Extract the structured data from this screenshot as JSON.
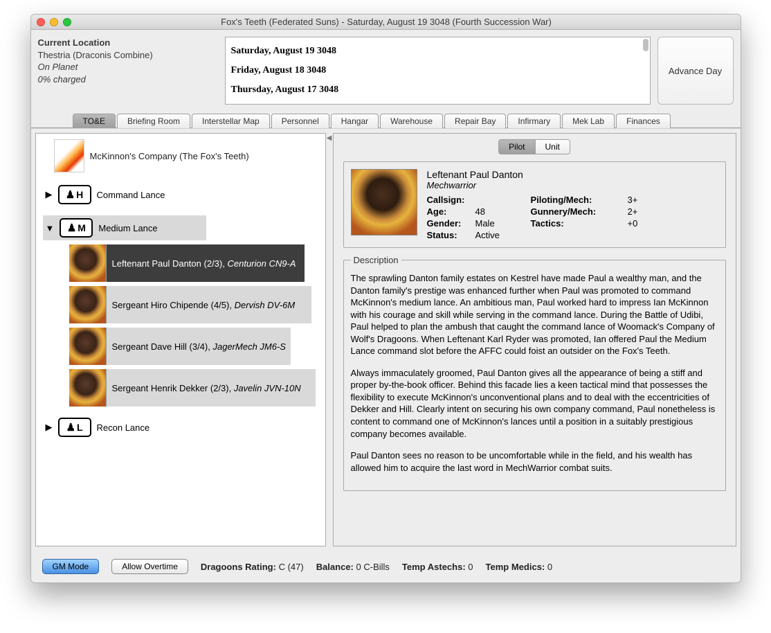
{
  "window": {
    "title": "Fox's Teeth (Federated Suns) - Saturday, August 19 3048 (Fourth Succession War)"
  },
  "location": {
    "heading": "Current Location",
    "system": "Thestria (Draconis Combine)",
    "status1": "On Planet",
    "status2": "0% charged"
  },
  "log": {
    "entries": [
      "Saturday, August 19 3048",
      "Friday, August 18 3048",
      "Thursday, August 17 3048"
    ]
  },
  "advance_label": "Advance Day",
  "tabs": [
    "TO&E",
    "Briefing Room",
    "Interstellar Map",
    "Personnel",
    "Hangar",
    "Warehouse",
    "Repair Bay",
    "Infirmary",
    "Mek Lab",
    "Finances"
  ],
  "active_tab": 0,
  "tree": {
    "company": "McKinnon's Company (The Fox's Teeth)",
    "lances": [
      {
        "letter": "H",
        "name": "Command Lance",
        "expanded": false,
        "pilots": []
      },
      {
        "letter": "M",
        "name": "Medium Lance",
        "expanded": true,
        "pilots": [
          {
            "name": "Leftenant Paul Danton",
            "rating": "(2/3)",
            "mech": "Centurion CN9-A",
            "selected": true
          },
          {
            "name": "Sergeant Hiro Chipende",
            "rating": "(4/5)",
            "mech": "Dervish DV-6M",
            "selected": false
          },
          {
            "name": "Sergeant Dave Hill",
            "rating": "(3/4)",
            "mech": "JagerMech JM6-S",
            "selected": false
          },
          {
            "name": "Sergeant Henrik Dekker",
            "rating": "(2/3)",
            "mech": "Javelin JVN-10N",
            "selected": false
          }
        ]
      },
      {
        "letter": "L",
        "name": "Recon Lance",
        "expanded": false,
        "pilots": []
      }
    ]
  },
  "detail": {
    "subtabs": [
      "Pilot",
      "Unit"
    ],
    "active_subtab": 0,
    "pilot": {
      "name": "Leftenant Paul Danton",
      "role": "Mechwarrior",
      "labels": {
        "callsign": "Callsign:",
        "age": "Age:",
        "gender": "Gender:",
        "status": "Status:",
        "piloting": "Piloting/Mech:",
        "gunnery": "Gunnery/Mech:",
        "tactics": "Tactics:"
      },
      "callsign": "",
      "age": "48",
      "gender": "Male",
      "status": "Active",
      "piloting": "3+",
      "gunnery": "2+",
      "tactics": "+0"
    },
    "description_heading": "Description",
    "description": [
      "The sprawling Danton family estates on Kestrel have made Paul a wealthy man, and the Danton family's prestige was enhanced further when Paul was promoted to command McKinnon's medium lance. An ambitious man, Paul worked hard to impress Ian McKinnon with his courage and skill while serving in the command lance. During the Battle of Udibi, Paul helped to plan the ambush that caught the command lance of Woomack's Company of Wolf's Dragoons. When Leftenant Karl Ryder was promoted, Ian offered Paul the Medium Lance command slot before the AFFC could foist an outsider on the Fox's Teeth.",
      "Always immaculately groomed, Paul Danton gives all the appearance of being a stiff and proper by-the-book officer. Behind this facade lies a keen tactical mind that possesses the flexibility to execute McKinnon's unconventional plans and to deal with the eccentricities of Dekker and Hill. Clearly intent on securing his own company command, Paul nonetheless is content to command one of McKinnon's lances until a position in a suitably prestigious company becomes available.",
      "Paul Danton sees no reason to be uncomfortable while in the field, and his wealth has allowed him to acquire the last word in MechWarrior combat suits."
    ]
  },
  "footer": {
    "gm_mode": "GM Mode",
    "allow_overtime": "Allow Overtime",
    "dragoons_label": "Dragoons Rating:",
    "dragoons_value": "C (47)",
    "balance_label": "Balance:",
    "balance_value": "0 C-Bills",
    "astechs_label": "Temp Astechs:",
    "astechs_value": "0",
    "medics_label": "Temp Medics:",
    "medics_value": "0"
  }
}
